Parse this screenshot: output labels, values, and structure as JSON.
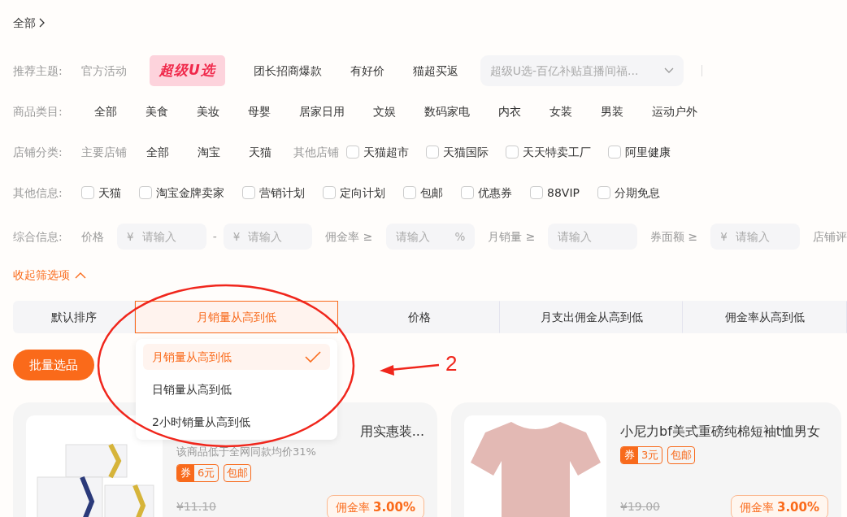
{
  "breadcrumb": {
    "label": "全部"
  },
  "theme": {
    "label": "推荐主题:",
    "sublabel": "官方活动",
    "logo": "超级U选",
    "items": [
      "团长招商爆款",
      "有好价",
      "猫超买返"
    ],
    "select": {
      "value": "超级U选-百亿补贴直播间福..."
    }
  },
  "category": {
    "label": "商品类目:",
    "items": [
      "全部",
      "美食",
      "美妆",
      "母婴",
      "居家日用",
      "文娱",
      "数码家电",
      "内衣",
      "女装",
      "男装",
      "运动户外"
    ]
  },
  "store": {
    "label": "店铺分类:",
    "main_label": "主要店铺",
    "main_items": [
      "全部",
      "淘宝",
      "天猫"
    ],
    "other_label": "其他店铺",
    "other_items": [
      {
        "label": "天猫超市",
        "checked": false
      },
      {
        "label": "天猫国际",
        "checked": false
      },
      {
        "label": "天天特卖工厂",
        "checked": false
      },
      {
        "label": "阿里健康",
        "checked": false
      }
    ]
  },
  "other": {
    "label": "其他信息:",
    "options": [
      {
        "label": "天猫",
        "checked": false
      },
      {
        "label": "淘宝金牌卖家",
        "checked": false
      },
      {
        "label": "营销计划",
        "checked": false
      },
      {
        "label": "定向计划",
        "checked": false
      },
      {
        "label": "包邮",
        "checked": false
      },
      {
        "label": "优惠券",
        "checked": false
      },
      {
        "label": "88VIP",
        "checked": false
      },
      {
        "label": "分期免息",
        "checked": false
      }
    ]
  },
  "info": {
    "label": "综合信息:",
    "items": [
      {
        "kind": "label",
        "text": "价格"
      },
      {
        "kind": "input",
        "prefix": "¥",
        "placeholder": "请输入"
      },
      {
        "kind": "dash",
        "text": "-"
      },
      {
        "kind": "input",
        "prefix": "¥",
        "placeholder": "请输入"
      },
      {
        "kind": "label",
        "text": "佣金率 ≥"
      },
      {
        "kind": "input",
        "placeholder": "请输入",
        "suffix": "%"
      },
      {
        "kind": "label",
        "text": "月销量 ≥"
      },
      {
        "kind": "input",
        "placeholder": "请输入"
      },
      {
        "kind": "label",
        "text": "券面额 ≥"
      },
      {
        "kind": "input",
        "prefix": "¥",
        "placeholder": "请输入"
      },
      {
        "kind": "label",
        "text": "店铺评"
      }
    ]
  },
  "collapse": {
    "label": "收起筛选项"
  },
  "sort_tabs": [
    {
      "label": "默认排序",
      "selected": false
    },
    {
      "label": "月销量从高到低",
      "selected": true
    },
    {
      "label": "价格",
      "selected": false
    },
    {
      "label": "月支出佣金从高到低",
      "selected": false
    },
    {
      "label": "佣金率从高到低",
      "selected": false
    }
  ],
  "sort_menu": {
    "options": [
      {
        "label": "月销量从高到低",
        "selected": true
      },
      {
        "label": "日销量从高到低",
        "selected": false
      },
      {
        "label": "2小时销量从高到低",
        "selected": false
      }
    ]
  },
  "batch_button": "批量选品",
  "products": [
    {
      "kind": "tissue",
      "title": "用实惠装...",
      "note": "该商品低于全网同款均价31%",
      "coupon_mark": "券",
      "coupon": "6元",
      "shipping": "包邮",
      "price": "¥11.10",
      "commission_label": "佣金率",
      "commission": "3.00%"
    },
    {
      "kind": "tshirt",
      "title": "小尼力bf美式重磅纯棉短袖t恤男女",
      "coupon_mark": "券",
      "coupon": "3元",
      "shipping": "包邮",
      "price": "¥19.00",
      "commission_label": "佣金率",
      "commission": "3.00%"
    }
  ],
  "annotation": {
    "label": "2"
  }
}
